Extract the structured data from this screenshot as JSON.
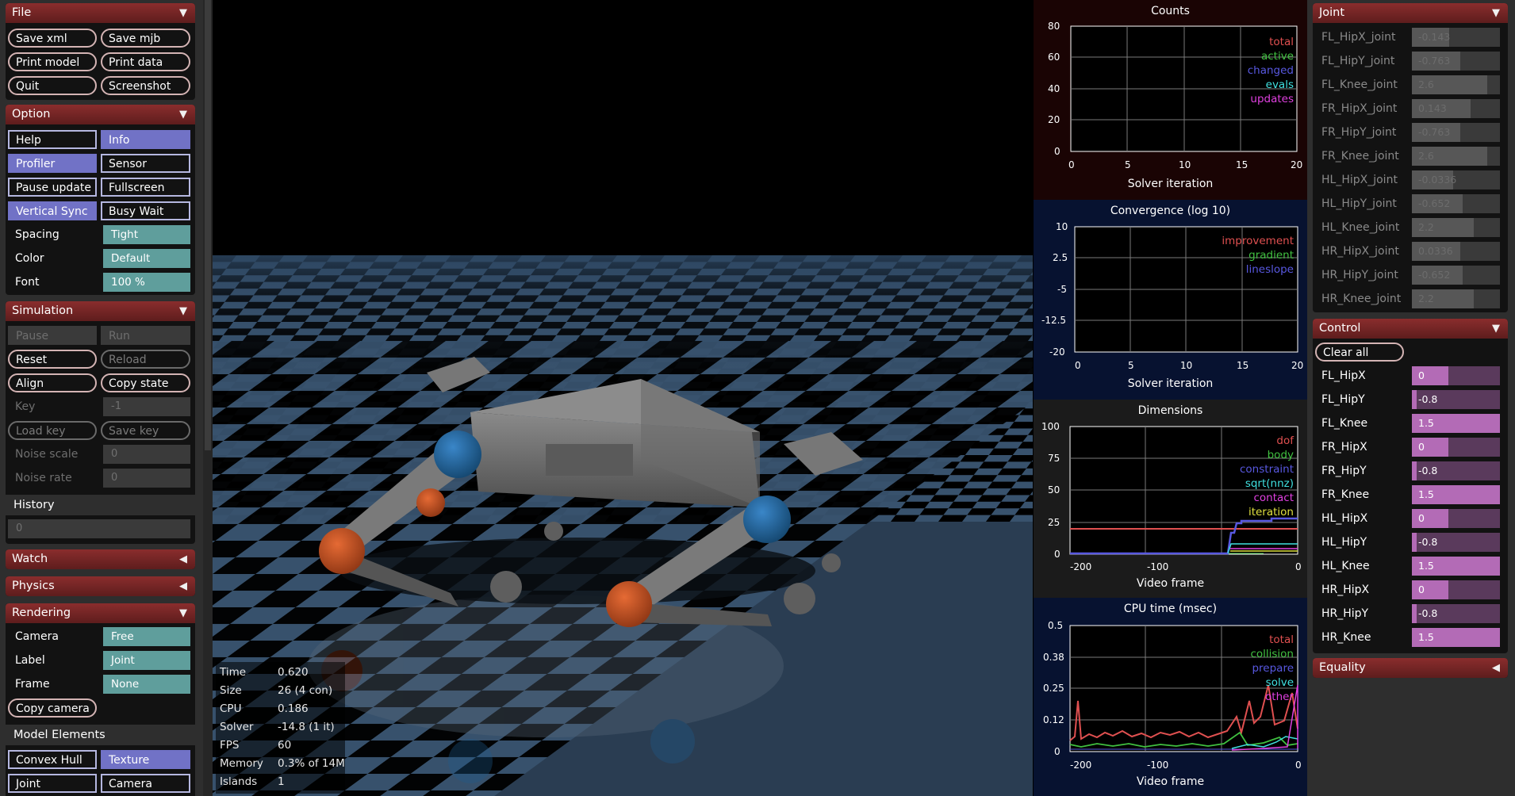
{
  "left": {
    "file": {
      "header": "File",
      "buttons": [
        "Save xml",
        "Save mjb",
        "Print model",
        "Print data",
        "Quit",
        "Screenshot"
      ]
    },
    "option": {
      "header": "Option",
      "toggles": [
        {
          "label": "Help",
          "on": false
        },
        {
          "label": "Info",
          "on": true
        },
        {
          "label": "Profiler",
          "on": true
        },
        {
          "label": "Sensor",
          "on": false
        },
        {
          "label": "Pause update",
          "on": false
        },
        {
          "label": "Fullscreen",
          "on": false
        },
        {
          "label": "Vertical Sync",
          "on": true
        },
        {
          "label": "Busy Wait",
          "on": false
        }
      ],
      "spacing_label": "Spacing",
      "spacing_value": "Tight",
      "color_label": "Color",
      "color_value": "Default",
      "font_label": "Font",
      "font_value": "100 %"
    },
    "simulation": {
      "header": "Simulation",
      "pause": "Pause",
      "run": "Run",
      "reset": "Reset",
      "reload": "Reload",
      "align": "Align",
      "copy_state": "Copy state",
      "key_label": "Key",
      "key_value": "-1",
      "load_key": "Load key",
      "save_key": "Save key",
      "noise_scale_label": "Noise scale",
      "noise_scale_value": "0",
      "noise_rate_label": "Noise rate",
      "noise_rate_value": "0",
      "history_label": "History",
      "history_value": "0"
    },
    "watch": {
      "header": "Watch"
    },
    "physics": {
      "header": "Physics"
    },
    "rendering": {
      "header": "Rendering",
      "camera_label": "Camera",
      "camera_value": "Free",
      "label_label": "Label",
      "label_value": "Joint",
      "frame_label": "Frame",
      "frame_value": "None",
      "copy_camera": "Copy camera",
      "model_elements": "Model Elements",
      "convex_hull": "Convex Hull",
      "texture": "Texture",
      "joint": "Joint",
      "camera": "Camera"
    }
  },
  "info": {
    "rows": [
      {
        "k": "Time",
        "v": "0.620"
      },
      {
        "k": "Size",
        "v": "26  (4 con)"
      },
      {
        "k": "CPU",
        "v": "0.186"
      },
      {
        "k": "Solver",
        "v": "-14.8  (1 it)"
      },
      {
        "k": "FPS",
        "v": "60"
      },
      {
        "k": "Memory",
        "v": "0.3% of 14M"
      },
      {
        "k": "Islands",
        "v": "1"
      }
    ]
  },
  "plots": {
    "counts": {
      "title": "Counts",
      "xlabel": "Solver iteration",
      "yticks": [
        "80",
        "60",
        "40",
        "20",
        "0"
      ],
      "xticks": [
        "0",
        "5",
        "10",
        "15",
        "20"
      ],
      "legend": [
        {
          "name": "total",
          "color": "#e05050"
        },
        {
          "name": "active",
          "color": "#40c040"
        },
        {
          "name": "changed",
          "color": "#5858e0"
        },
        {
          "name": "evals",
          "color": "#40e0e0"
        },
        {
          "name": "updates",
          "color": "#e040e0"
        }
      ]
    },
    "convergence": {
      "title": "Convergence (log 10)",
      "xlabel": "Solver iteration",
      "yticks": [
        "10",
        "2.5",
        "-5",
        "-12.5",
        "-20"
      ],
      "xticks": [
        "0",
        "5",
        "10",
        "15",
        "20"
      ],
      "legend": [
        {
          "name": "improvement",
          "color": "#e05050"
        },
        {
          "name": "gradient",
          "color": "#40c040"
        },
        {
          "name": "lineslope",
          "color": "#5858e0"
        }
      ]
    },
    "dimensions": {
      "title": "Dimensions",
      "xlabel": "Video frame",
      "yticks": [
        "100",
        "75",
        "50",
        "25",
        "0"
      ],
      "xticks": [
        "-200",
        "-100",
        "0"
      ],
      "legend": [
        {
          "name": "dof",
          "color": "#e05050"
        },
        {
          "name": "body",
          "color": "#40c040"
        },
        {
          "name": "constraint",
          "color": "#5858e0"
        },
        {
          "name": "sqrt(nnz)",
          "color": "#40e0e0"
        },
        {
          "name": "contact",
          "color": "#e040e0"
        },
        {
          "name": "iteration",
          "color": "#e0e040"
        }
      ]
    },
    "cpu": {
      "title": "CPU time (msec)",
      "xlabel": "Video frame",
      "yticks": [
        "0.5",
        "0.38",
        "0.25",
        "0.12",
        "0"
      ],
      "xticks": [
        "-200",
        "-100",
        "0"
      ],
      "legend": [
        {
          "name": "total",
          "color": "#e05050"
        },
        {
          "name": "collision",
          "color": "#40c040"
        },
        {
          "name": "prepare",
          "color": "#5858e0"
        },
        {
          "name": "solve",
          "color": "#40e0e0"
        },
        {
          "name": "other",
          "color": "#e040e0"
        }
      ]
    }
  },
  "right": {
    "joint": {
      "header": "Joint",
      "rows": [
        {
          "label": "FL_HipX_joint",
          "value": "-0.143",
          "level": 0.42
        },
        {
          "label": "FL_HipY_joint",
          "value": "-0.763",
          "level": 0.55
        },
        {
          "label": "FL_Knee_joint",
          "value": "2.6",
          "level": 0.86
        },
        {
          "label": "FR_HipX_joint",
          "value": "0.143",
          "level": 0.67
        },
        {
          "label": "FR_HipY_joint",
          "value": "-0.763",
          "level": 0.55
        },
        {
          "label": "FR_Knee_joint",
          "value": "2.6",
          "level": 0.86
        },
        {
          "label": "HL_HipX_joint",
          "value": "-0.0336",
          "level": 0.47
        },
        {
          "label": "HL_HipY_joint",
          "value": "-0.652",
          "level": 0.58
        },
        {
          "label": "HL_Knee_joint",
          "value": "2.2",
          "level": 0.7
        },
        {
          "label": "HR_HipX_joint",
          "value": "0.0336",
          "level": 0.55
        },
        {
          "label": "HR_HipY_joint",
          "value": "-0.652",
          "level": 0.58
        },
        {
          "label": "HR_Knee_joint",
          "value": "2.2",
          "level": 0.7
        }
      ]
    },
    "control": {
      "header": "Control",
      "clear_all": "Clear all",
      "rows": [
        {
          "label": "FL_HipX",
          "value": "0",
          "level": 0.41
        },
        {
          "label": "FL_HipY",
          "value": "-0.8",
          "level": 0.05
        },
        {
          "label": "FL_Knee",
          "value": "1.5",
          "level": 1.0
        },
        {
          "label": "FR_HipX",
          "value": "0",
          "level": 0.41
        },
        {
          "label": "FR_HipY",
          "value": "-0.8",
          "level": 0.05
        },
        {
          "label": "FR_Knee",
          "value": "1.5",
          "level": 1.0
        },
        {
          "label": "HL_HipX",
          "value": "0",
          "level": 0.41
        },
        {
          "label": "HL_HipY",
          "value": "-0.8",
          "level": 0.05
        },
        {
          "label": "HL_Knee",
          "value": "1.5",
          "level": 1.0
        },
        {
          "label": "HR_HipX",
          "value": "0",
          "level": 0.41
        },
        {
          "label": "HR_HipY",
          "value": "-0.8",
          "level": 0.05
        },
        {
          "label": "HR_Knee",
          "value": "1.5",
          "level": 1.0
        }
      ]
    },
    "equality": {
      "header": "Equality"
    }
  },
  "colors": {
    "header_red": "#7a2626",
    "toggle_on": "#7172c6",
    "teal": "#5f9e9c",
    "control_fill": "#b36bb6",
    "floor_light": "#38526d",
    "floor_dark": "#000000"
  }
}
